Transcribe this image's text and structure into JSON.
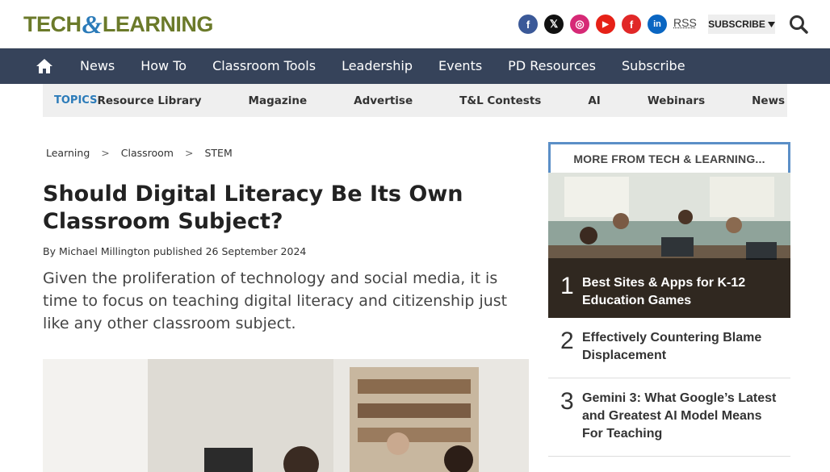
{
  "header": {
    "logo_text_left": "TECH",
    "logo_amp": "&",
    "logo_text_right": "LEARNING",
    "social": [
      {
        "icon": "facebook-icon",
        "glyph": "f",
        "color": "#3b5998"
      },
      {
        "icon": "x-icon",
        "glyph": "𝕏",
        "color": "#111111"
      },
      {
        "icon": "instagram-icon",
        "glyph": "◎",
        "color": "#d62976"
      },
      {
        "icon": "youtube-icon",
        "glyph": "▶",
        "color": "#e62117"
      },
      {
        "icon": "flipboard-icon",
        "glyph": "f",
        "color": "#e12828"
      },
      {
        "icon": "linkedin-icon",
        "glyph": "in",
        "color": "#0a66c2"
      }
    ],
    "rss": "RSS",
    "subscribe": "SUBSCRIBE"
  },
  "nav": {
    "items": [
      "News",
      "How To",
      "Classroom Tools",
      "Leadership",
      "Events",
      "PD Resources",
      "Subscribe"
    ]
  },
  "topics": {
    "label": "TOPICS",
    "items": [
      "Resource Library",
      "Magazine",
      "Advertise",
      "T&L Contests",
      "AI",
      "Webinars",
      "News Sig"
    ]
  },
  "breadcrumb": [
    "Learning",
    "Classroom",
    "STEM"
  ],
  "article": {
    "title": "Should Digital Literacy Be Its Own Classroom Subject?",
    "byline_prefix": "By",
    "author": "Michael Millington",
    "published_label": "published",
    "date": "26 September 2024",
    "dek": "Given the proliferation of technology and social media, it is time to focus on teaching digital literacy and citizenship just like any other classroom subject."
  },
  "sidebar": {
    "heading": "MORE FROM TECH & LEARNING...",
    "items": [
      {
        "rank": "1",
        "title": "Best Sites & Apps for K-12 Education Games"
      },
      {
        "rank": "2",
        "title": "Effectively Countering Blame Displacement"
      },
      {
        "rank": "3",
        "title": "Gemini 3: What Google’s Latest and Greatest AI Model Means For Teaching"
      }
    ]
  },
  "colors": {
    "nav_bg": "#36435a",
    "accent_blue": "#2b7bb9",
    "logo_olive": "#6b7a2a",
    "sidebar_border": "#5b8fc7"
  }
}
